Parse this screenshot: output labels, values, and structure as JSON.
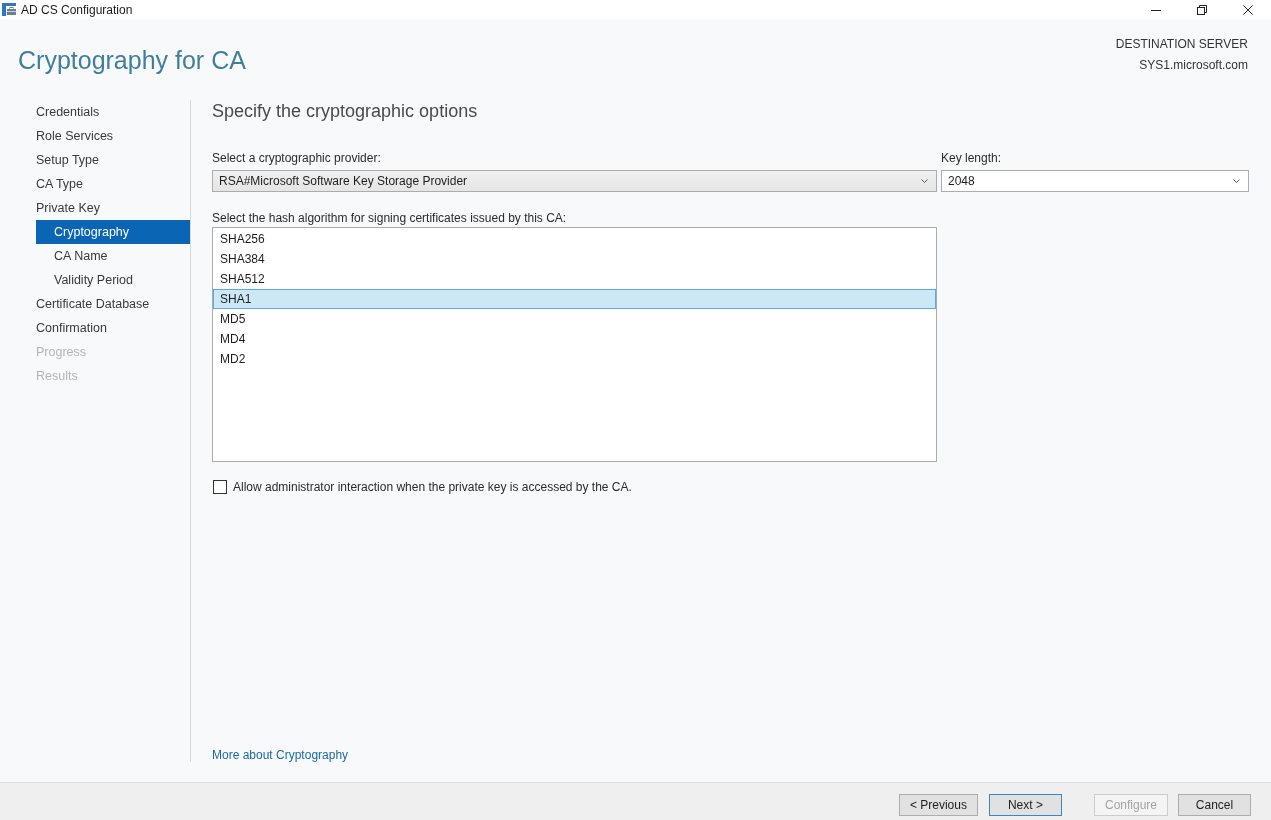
{
  "window": {
    "title": "AD CS Configuration"
  },
  "header": {
    "title": "Cryptography for CA",
    "server_label": "DESTINATION SERVER",
    "server_name": "SYS1.microsoft.com"
  },
  "sidebar": {
    "items": [
      {
        "label": "Credentials",
        "selected": false,
        "disabled": false
      },
      {
        "label": "Role Services",
        "selected": false,
        "disabled": false
      },
      {
        "label": "Setup Type",
        "selected": false,
        "disabled": false
      },
      {
        "label": "CA Type",
        "selected": false,
        "disabled": false
      },
      {
        "label": "Private Key",
        "selected": false,
        "disabled": false,
        "children": [
          {
            "label": "Cryptography",
            "selected": true,
            "disabled": false
          },
          {
            "label": "CA Name",
            "selected": false,
            "disabled": false
          },
          {
            "label": "Validity Period",
            "selected": false,
            "disabled": false
          }
        ]
      },
      {
        "label": "Certificate Database",
        "selected": false,
        "disabled": false
      },
      {
        "label": "Confirmation",
        "selected": false,
        "disabled": false
      },
      {
        "label": "Progress",
        "selected": false,
        "disabled": true
      },
      {
        "label": "Results",
        "selected": false,
        "disabled": true
      }
    ]
  },
  "content": {
    "heading": "Specify the cryptographic options",
    "provider": {
      "label": "Select a cryptographic provider:",
      "value": "RSA#Microsoft Software Key Storage Provider"
    },
    "key_length": {
      "label": "Key length:",
      "value": "2048"
    },
    "hash": {
      "label": "Select the hash algorithm for signing certificates issued by this CA:",
      "items": [
        {
          "label": "SHA256",
          "selected": false
        },
        {
          "label": "SHA384",
          "selected": false
        },
        {
          "label": "SHA512",
          "selected": false
        },
        {
          "label": "SHA1",
          "selected": true
        },
        {
          "label": "MD5",
          "selected": false
        },
        {
          "label": "MD4",
          "selected": false
        },
        {
          "label": "MD2",
          "selected": false
        }
      ]
    },
    "allow_interaction": {
      "label": "Allow administrator interaction when the private key is accessed by the CA.",
      "checked": false
    },
    "link": "More about Cryptography"
  },
  "buttons": [
    {
      "label": "< Previous",
      "disabled": false,
      "focused": false
    },
    {
      "label": "Next >",
      "disabled": false,
      "focused": true
    },
    {
      "label": "Configure",
      "disabled": true,
      "focused": false
    },
    {
      "label": "Cancel",
      "disabled": false,
      "focused": false
    }
  ]
}
